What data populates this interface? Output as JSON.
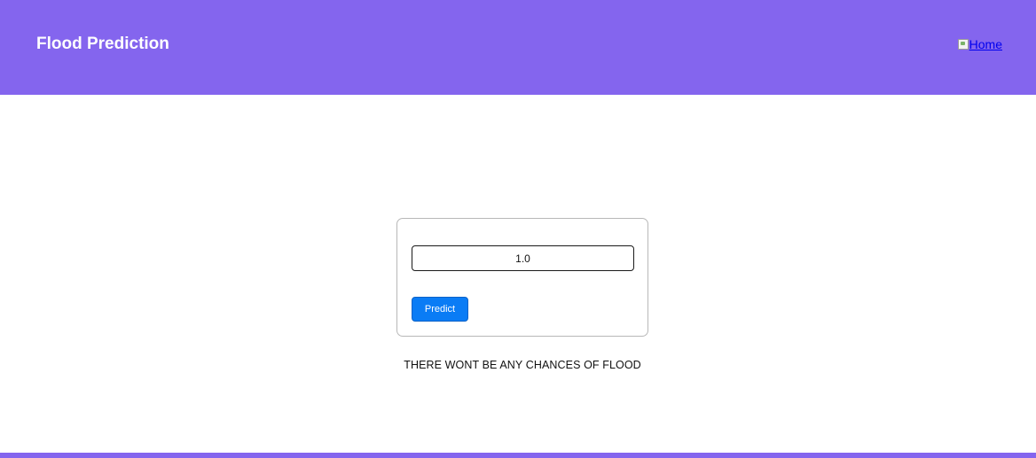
{
  "header": {
    "title": "Flood Prediction",
    "nav": {
      "home_label": "Home",
      "home_icon": "broken-image-icon"
    }
  },
  "form": {
    "input_value": "1.0",
    "predict_label": "Predict"
  },
  "result": {
    "message": "THERE WONT BE ANY CHANCES OF FLOOD"
  },
  "colors": {
    "header_bg": "#8465ee",
    "button_bg": "#0a7cf5",
    "link": "#0000ee"
  }
}
